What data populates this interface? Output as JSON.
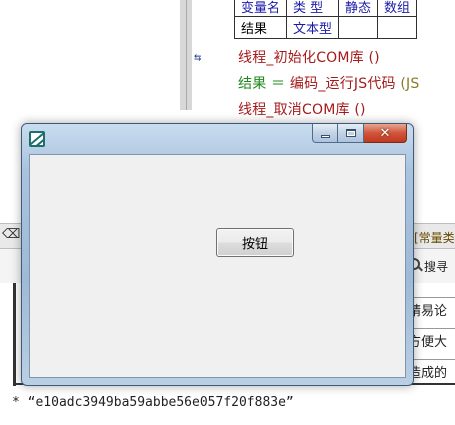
{
  "ide": {
    "var_table": {
      "headers": [
        "变量名",
        "类 型",
        "静态",
        "数组"
      ],
      "row": {
        "name": "结果",
        "type": "文本型",
        "static": "",
        "array": ""
      }
    },
    "gutter_marker": "⇆",
    "code_lines": [
      {
        "text": "线程_初始化COM库 ()"
      },
      {
        "target": "结果",
        "op": " ＝ ",
        "call": "编码_运行JS代码",
        "arg": " (JS"
      },
      {
        "text": "线程_取消COM库 ()"
      }
    ],
    "lower_panel": {
      "constant_tab": "[常量类",
      "search_label": "搜寻",
      "side_texts": [
        "精易论",
        "方便大",
        "造成的"
      ]
    },
    "status_line": "*  “e10adc3949ba59abbe56e057f20f883e”"
  },
  "dialog": {
    "icon": "app-icon",
    "caption": {
      "minimize": "minimize-icon",
      "maximize": "maximize-icon",
      "close_glyph": "✕"
    },
    "button_label": "按钮"
  },
  "colors": {
    "keyword_red": "#a51b1b",
    "variable_green": "#1c8a1c",
    "table_blue": "#1a1aa8",
    "close_red": "#c1391f"
  }
}
